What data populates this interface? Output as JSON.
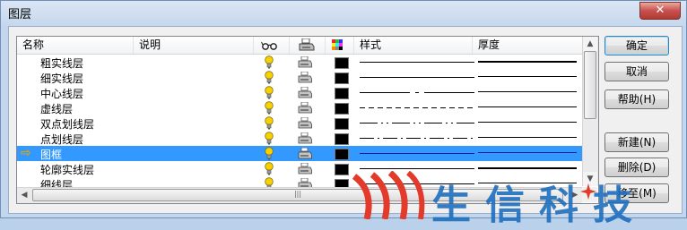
{
  "window": {
    "title": "图层",
    "close_glyph": "✕"
  },
  "columns": [
    {
      "key": "name",
      "label": "名称"
    },
    {
      "key": "desc",
      "label": "说明"
    },
    {
      "key": "on",
      "icon": "glasses-icon"
    },
    {
      "key": "plot",
      "icon": "printer-icon"
    },
    {
      "key": "color",
      "icon": "color-grid-icon"
    },
    {
      "key": "linetype",
      "label": "样式"
    },
    {
      "key": "lineweight",
      "label": "厚度"
    }
  ],
  "layers": [
    {
      "name": "粗实线层",
      "linetype": "solid",
      "weight": "thick",
      "current": false,
      "selected": false
    },
    {
      "name": "细实线层",
      "linetype": "solid",
      "weight": "thin",
      "current": false,
      "selected": false
    },
    {
      "name": "中心线层",
      "linetype": "center",
      "weight": "thin",
      "current": false,
      "selected": false
    },
    {
      "name": "虚线层",
      "linetype": "dashed",
      "weight": "thin",
      "current": false,
      "selected": false
    },
    {
      "name": "双点划线层",
      "linetype": "phantom",
      "weight": "thin",
      "current": false,
      "selected": false
    },
    {
      "name": "点划线层",
      "linetype": "dashdot",
      "weight": "thin",
      "current": false,
      "selected": false
    },
    {
      "name": "图框",
      "linetype": "solid",
      "weight": "thin",
      "current": true,
      "selected": true
    },
    {
      "name": "轮廓实线层",
      "linetype": "solid",
      "weight": "thick",
      "current": false,
      "selected": false
    },
    {
      "name": "细线层",
      "linetype": "solid",
      "weight": "thin",
      "current": false,
      "selected": false
    }
  ],
  "buttons": {
    "ok": "确定",
    "cancel": "取消",
    "help": "帮助(H)",
    "new": "新建(N)",
    "delete": "删除(D)",
    "move": "移至(M)"
  },
  "watermark": {
    "text": "生信科技"
  },
  "colors": {
    "selection": "#3399ff",
    "layer_color": "#000000",
    "bulb": "#f5d200"
  }
}
